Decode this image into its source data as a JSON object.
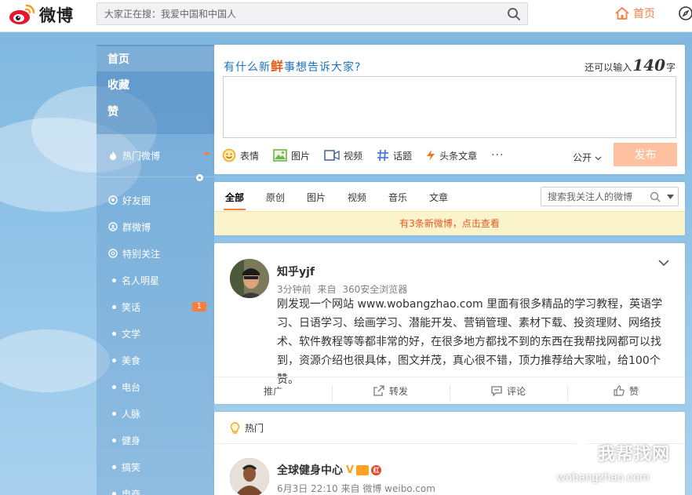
{
  "header": {
    "logo_text": "微博",
    "search_placeholder": "大家正在搜：我爱中国和中国人",
    "home_label": "首页"
  },
  "sidebar": {
    "main_items": [
      {
        "label": "首页",
        "active": true
      },
      {
        "label": "收藏"
      },
      {
        "label": "赞"
      }
    ],
    "hot_label": "热门微博",
    "groups": [
      {
        "label": "好友圈",
        "icon": "friends-circle-icon"
      },
      {
        "label": "群微博",
        "icon": "group-icon"
      },
      {
        "label": "特别关注",
        "icon": "star-icon"
      }
    ],
    "sub_groups": [
      {
        "label": "名人明星"
      },
      {
        "label": "笑话",
        "badge": "1"
      },
      {
        "label": "文学"
      },
      {
        "label": "美食"
      },
      {
        "label": "电台"
      },
      {
        "label": "人脉"
      },
      {
        "label": "健身"
      },
      {
        "label": "搞笑"
      },
      {
        "label": "电商"
      }
    ]
  },
  "publisher": {
    "prompt": "有什么新鲜事想告诉大家?",
    "prompt_pre": "有什么新",
    "prompt_emph": "鲜",
    "prompt_post": "事想告诉大家?",
    "remaining_prefix": "还可以输入",
    "remaining_count": "140",
    "remaining_suffix": "字",
    "tools": [
      {
        "label": "表情",
        "icon": "emoji-icon"
      },
      {
        "label": "图片",
        "icon": "image-icon"
      },
      {
        "label": "视频",
        "icon": "video-icon"
      },
      {
        "label": "话题",
        "icon": "hashtag-icon"
      },
      {
        "label": "头条文章",
        "icon": "lightning-icon"
      }
    ],
    "more_label": "···",
    "visibility_label": "公开",
    "publish_label": "发布",
    "colors": {
      "accent": "#fa7d3c",
      "publish_disabled": "#ffc09f",
      "prompt": "#1a73c2"
    }
  },
  "feed": {
    "tabs": [
      {
        "label": "全部",
        "active": true
      },
      {
        "label": "原创"
      },
      {
        "label": "图片"
      },
      {
        "label": "视频"
      },
      {
        "label": "音乐"
      },
      {
        "label": "文章"
      }
    ],
    "search_placeholder": "搜索我关注人的微博",
    "new_posts_label": "有3条新微博，点击查看"
  },
  "posts": [
    {
      "author": "知乎yjf",
      "time": "3分钟前",
      "source_prefix": "来自",
      "source": "360安全浏览器",
      "text": "刚发现一个网站 www.wobangzhao.com 里面有很多精品的学习教程，英语学习、日语学习、绘画学习、潜能开发、营销管理、素材下载、投资理财、网络技术、软件教程等等都非常的好，在很多地方都找不到的东西在我帮找网都可以找到，资源介绍也很具体，图文并茂，真心很不错，顶力推荐给大家啦，给100个赞。",
      "actions": [
        {
          "label": "推广",
          "icon": ""
        },
        {
          "label": "转发",
          "icon": "repost-icon"
        },
        {
          "label": "评论",
          "icon": "comment-icon"
        },
        {
          "label": "赞",
          "icon": "thumbs-up-icon"
        }
      ]
    }
  ],
  "hot_card": {
    "label": "热门",
    "author": "全球健身中心",
    "verified_mark": "V",
    "red_badge_text": "红",
    "time": "6月3日 22:10",
    "source_prefix": "来自",
    "source": "微博 weibo.com"
  },
  "watermark": {
    "cn": "我帮找网",
    "en": "wobangzhao.com"
  }
}
